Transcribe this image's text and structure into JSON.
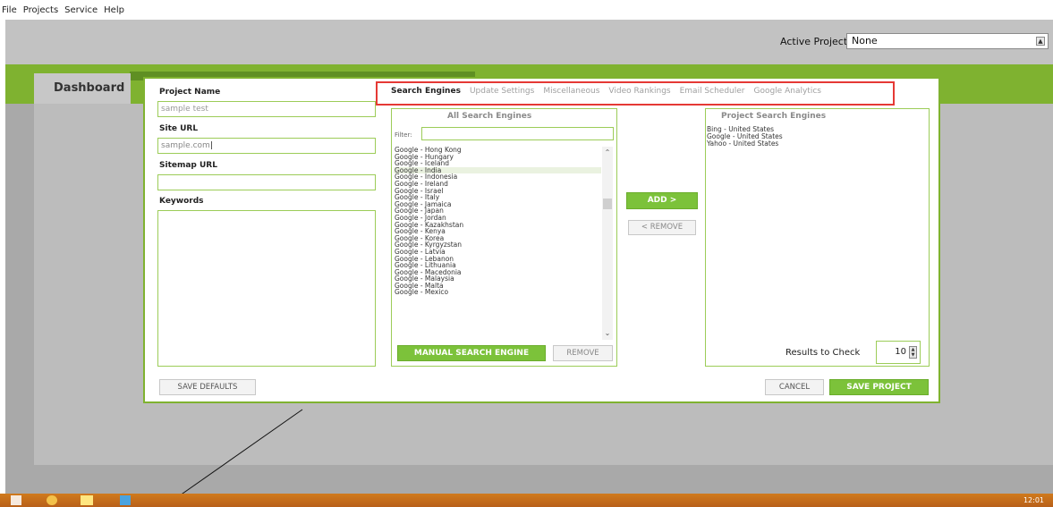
{
  "menu": [
    "File",
    "Projects",
    "Service",
    "Help"
  ],
  "header": {
    "active_project_label": "Active Project",
    "active_project_value": "None"
  },
  "dashboard_tab": "Dashboard",
  "form": {
    "project_name_label": "Project Name",
    "project_name_value": "sample test",
    "site_url_label": "Site URL",
    "site_url_value": "sample.com",
    "sitemap_url_label": "Sitemap URL",
    "sitemap_url_value": "",
    "keywords_label": "Keywords"
  },
  "tabs": [
    "Search Engines",
    "Update Settings",
    "Miscellaneous",
    "Video Rankings",
    "Email Scheduler",
    "Google Analytics"
  ],
  "all_engines": {
    "title": "All Search Engines",
    "filter_label": "Filter:",
    "filter_value": "",
    "items": [
      "Google - Hong Kong",
      "Google - Hungary",
      "Google - Iceland",
      "Google - India",
      "Google - Indonesia",
      "Google - Ireland",
      "Google - Israel",
      "Google - Italy",
      "Google - Jamaica",
      "Google - Japan",
      "Google - Jordan",
      "Google - Kazakhstan",
      "Google - Kenya",
      "Google - Korea",
      "Google - Kyrgyzstan",
      "Google - Latvia",
      "Google - Lebanon",
      "Google - Lithuania",
      "Google - Macedonia",
      "Google - Malaysia",
      "Google - Malta",
      "Google - Mexico"
    ],
    "selected_index": 3,
    "manual_button": "MANUAL SEARCH ENGINE",
    "remove_button": "REMOVE"
  },
  "middle": {
    "add_button": "ADD >",
    "remove_button": "< REMOVE"
  },
  "project_engines": {
    "title": "Project Search Engines",
    "items": [
      "Bing - United States",
      "Google - United States",
      "Yahoo - United States"
    ],
    "results_label": "Results to Check",
    "results_value": "10"
  },
  "footer": {
    "save_defaults": "SAVE DEFAULTS",
    "cancel": "CANCEL",
    "save_project": "SAVE PROJECT"
  },
  "taskbar": {
    "clock": "12:01"
  },
  "colors": {
    "accent_green": "#7cc23a",
    "band_green": "#7fb230",
    "highlight_red": "#e53935",
    "taskbar_orange": "#c86e1a"
  }
}
